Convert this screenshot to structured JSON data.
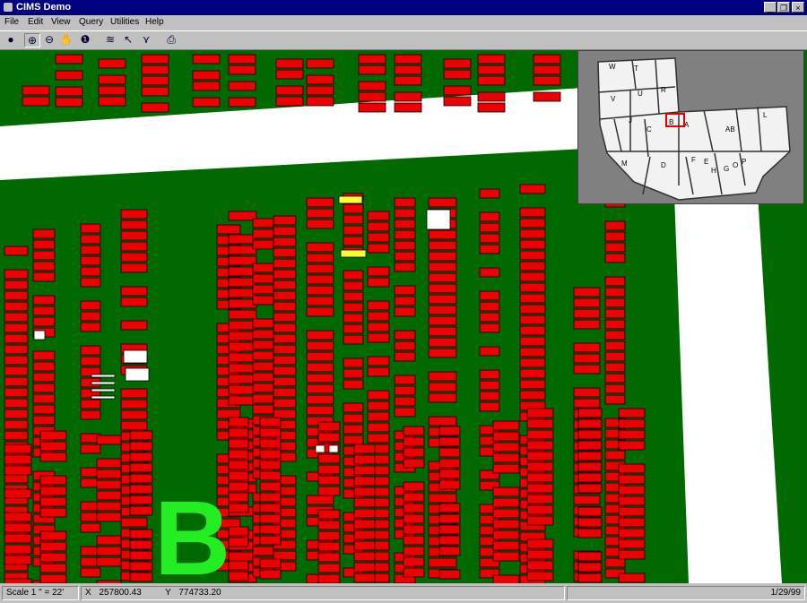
{
  "window": {
    "title": "CIMS Demo",
    "controls": {
      "minimize": "_",
      "restore": "❐",
      "close": "×"
    }
  },
  "menu": [
    "File",
    "Edit",
    "View",
    "Query",
    "Utilities",
    "Help"
  ],
  "toolbar": [
    {
      "name": "globe-icon",
      "glyph": "●"
    },
    {
      "name": "zoom-in-icon",
      "glyph": "⊕"
    },
    {
      "name": "zoom-out-icon",
      "glyph": "⊖"
    },
    {
      "name": "pan-hand-icon",
      "glyph": "✋"
    },
    {
      "name": "info-icon",
      "glyph": "❶"
    },
    {
      "name": "layers-icon",
      "glyph": "≋"
    },
    {
      "name": "pointer-select-icon",
      "glyph": "↖"
    },
    {
      "name": "query-filter-icon",
      "glyph": "⋎"
    },
    {
      "name": "print-icon",
      "glyph": "⎙"
    }
  ],
  "map": {
    "label": "B",
    "colors": {
      "ground": "#006a00",
      "parcel": "#ee0000",
      "selected": "#ffff33",
      "vacant": "#ffffff",
      "label": "#22ee22"
    }
  },
  "overview": {
    "sections": [
      "W",
      "T",
      "V",
      "U",
      "R",
      "J",
      "C",
      "B",
      "A",
      "AB",
      "L",
      "M",
      "D",
      "F",
      "E",
      "H",
      "G",
      "O",
      "P"
    ]
  },
  "status": {
    "scale": "Scale 1 \" = 22'",
    "x": "X 257800.43",
    "y": "Y 774733.20",
    "date": "1/29/99"
  }
}
